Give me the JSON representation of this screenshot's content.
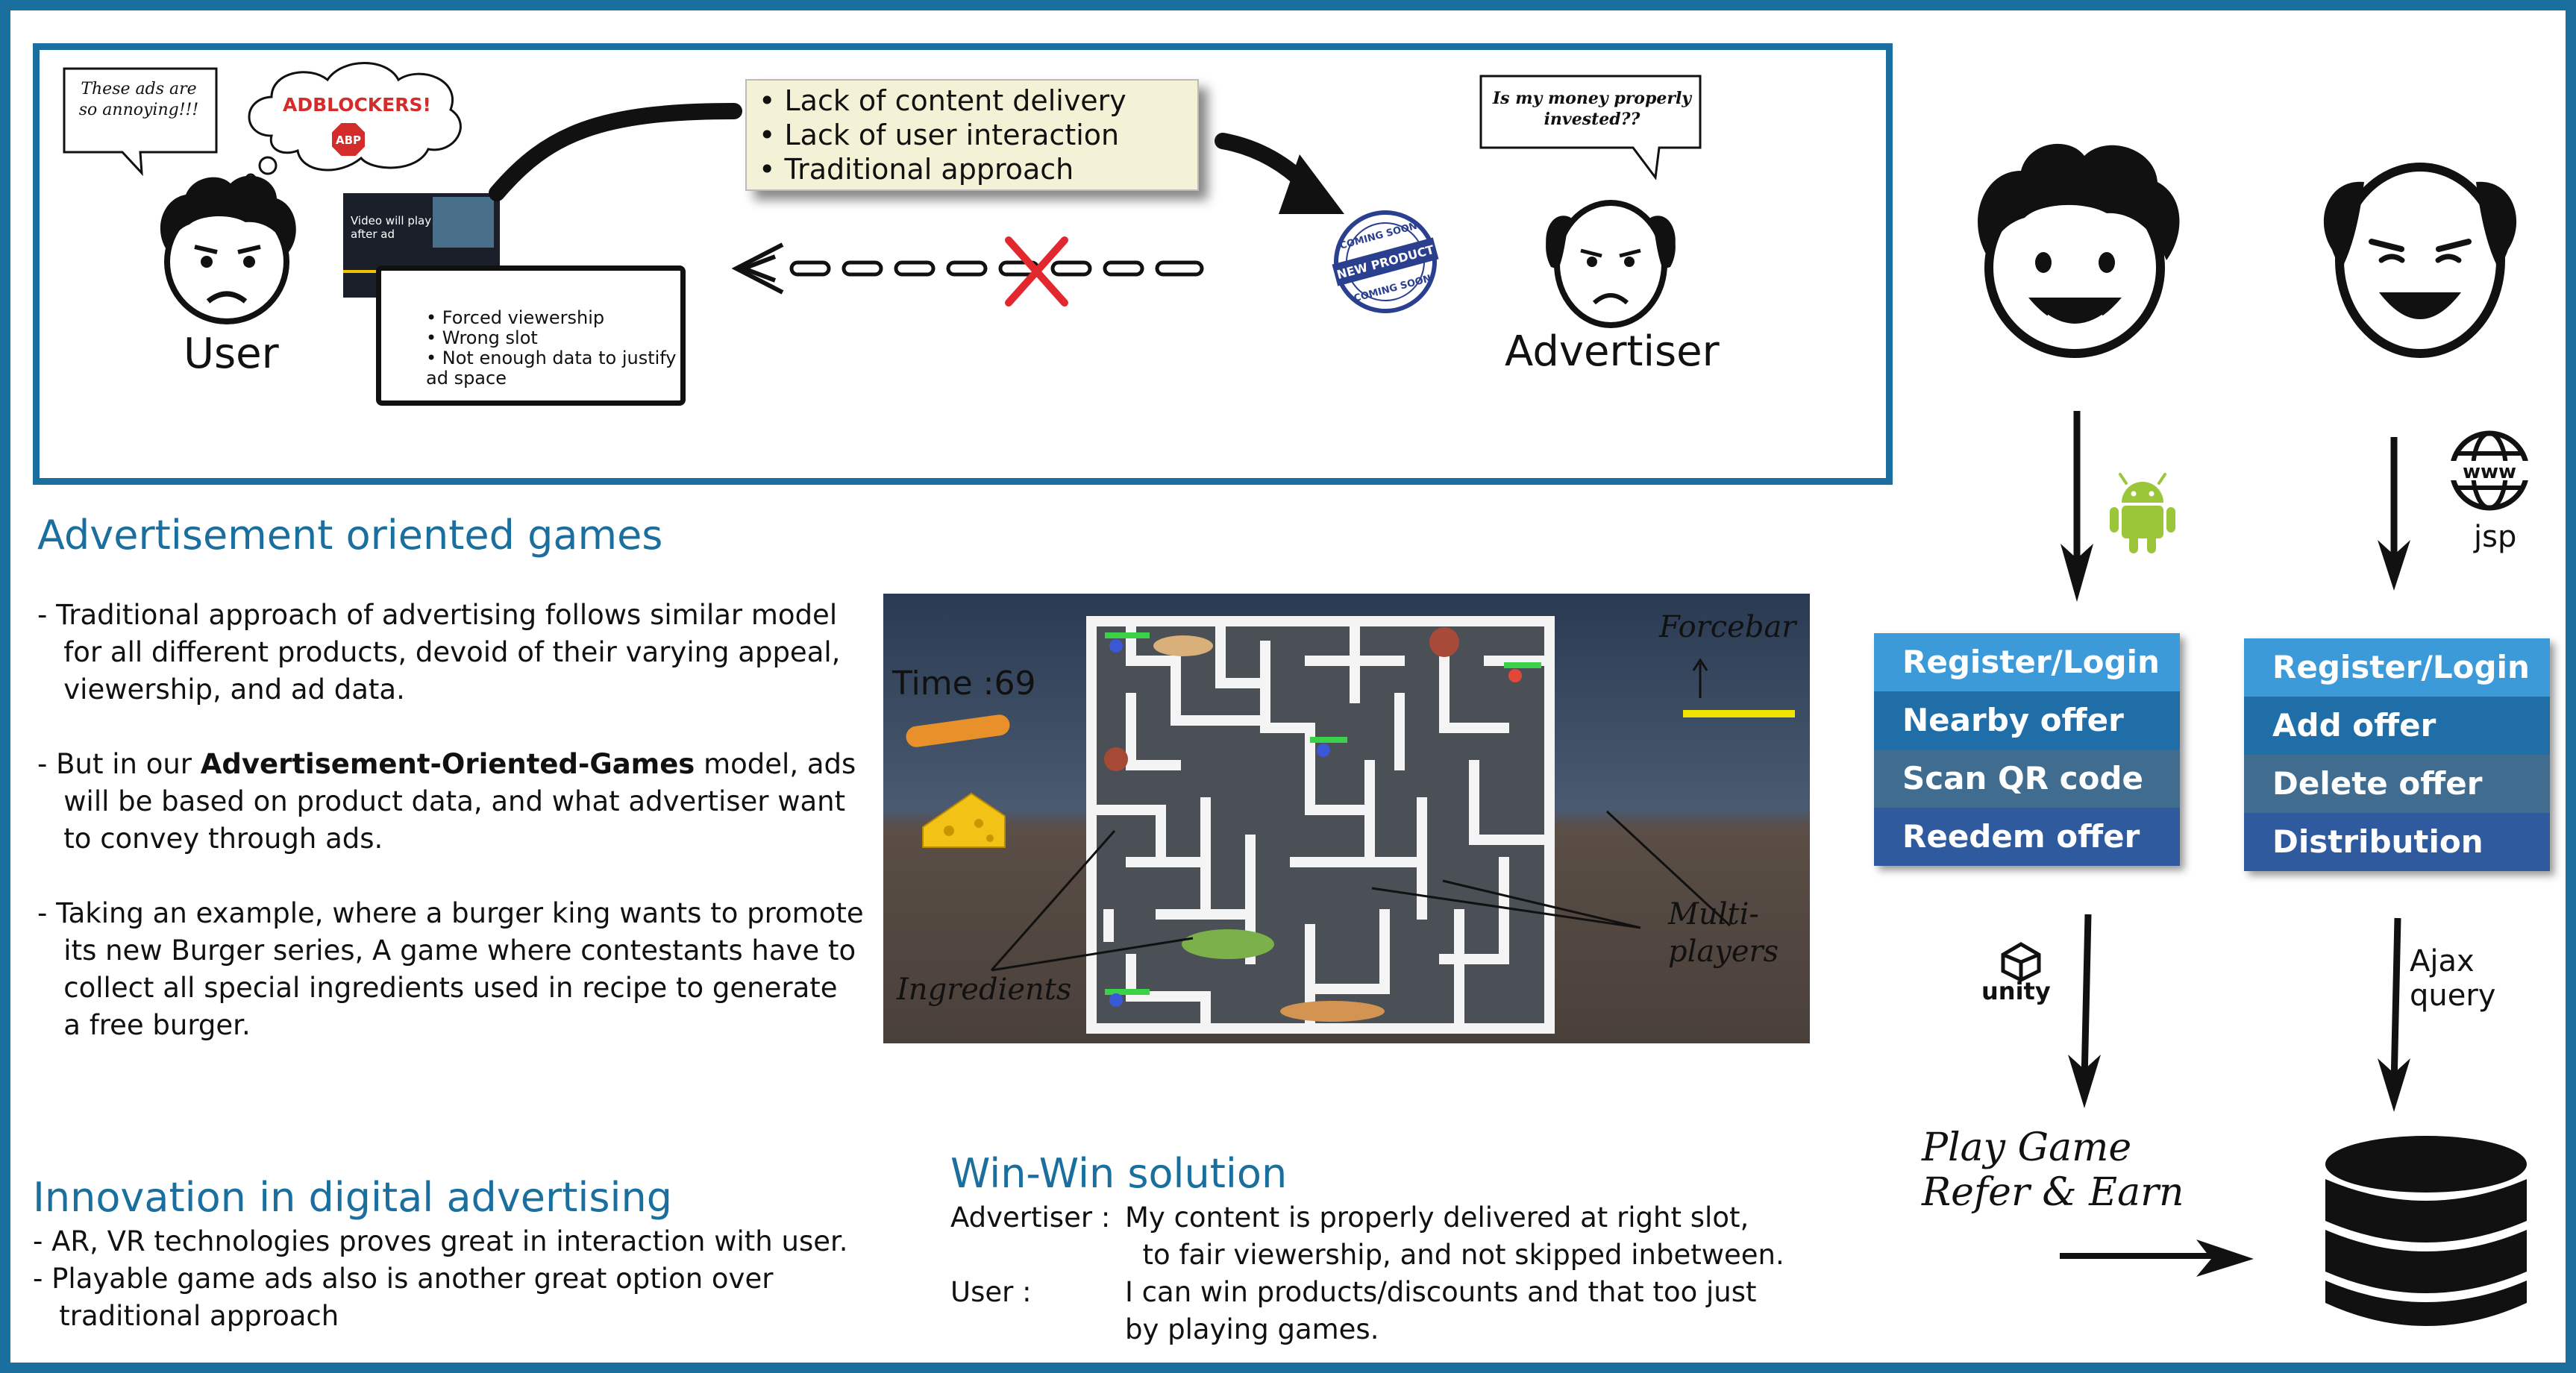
{
  "panel": {
    "user_bubble": [
      "These ads are",
      "so annoying!!!"
    ],
    "adblock_label": "ADBLOCKERS!",
    "abp_label": "ABP",
    "user_label": "User",
    "video_text": [
      "Video will play",
      "after ad"
    ],
    "user_issues": [
      "• Forced viewership",
      "• Wrong slot",
      "• Not enough data to justify",
      "   ad space"
    ],
    "advertiser_issues": [
      "• Lack of content delivery",
      "• Lack of user interaction",
      "• Traditional approach"
    ],
    "stamp_text": [
      "COMING SOON",
      "NEW PRODUCT",
      "COMING SOON"
    ],
    "advertiser_bubble": [
      "Is my money properly",
      "invested??"
    ],
    "advertiser_label": "Advertiser"
  },
  "games": {
    "title": "Advertisement oriented games",
    "p1": [
      "- Traditional approach of advertising follows similar model",
      "   for all different products, devoid of their varying appeal,",
      "   viewership, and ad data."
    ],
    "p2_prefix": "- But in our ",
    "p2_bold": "Advertisement-Oriented-Games",
    "p2_suffix": " model, ads",
    "p2_rest": [
      "   will be based on product data, and what advertiser want",
      "   to convey through ads."
    ],
    "p3": [
      "- Taking an example, where a burger king wants to promote",
      "   its new Burger series, A game where contestants have to",
      "   collect all special ingredients used in recipe to generate",
      "   a free burger."
    ]
  },
  "game_screen": {
    "time": "Time :69",
    "forcebar": "Forcebar",
    "ingredients": "Ingredients",
    "multiplayers": [
      "Multi-",
      "players"
    ]
  },
  "innovation": {
    "title": "Innovation in digital advertising",
    "lines": [
      "- AR, VR technologies proves great in interaction with user.",
      "- Playable game ads also is another great option over",
      "   traditional approach"
    ]
  },
  "winwin": {
    "title": "Win-Win solution",
    "advertiser_label": "Advertiser :",
    "advertiser_lines": [
      "My content is properly delivered at right slot,",
      "  to fair viewership, and not skipped inbetween."
    ],
    "user_label": "User :",
    "user_lines": [
      "I can win products/discounts and that too just",
      "by playing games."
    ]
  },
  "architecture": {
    "jsp_label": "jsp",
    "unity_label": "unity",
    "ajax_label": "Ajax query",
    "user_menu": [
      "Register/Login",
      "Nearby offer",
      "Scan  QR  code",
      "Reedem offer"
    ],
    "advertiser_menu": [
      "Register/Login",
      "Add  offer",
      "Delete  offer",
      "Distribution"
    ],
    "play_game": [
      "Play Game",
      "Refer & Earn"
    ]
  },
  "colors": {
    "accent": "#1a6f9e",
    "menu_1": "#3d9ad9",
    "menu_2": "#1f6ea8",
    "menu_3": "#3f6c8f",
    "menu_4": "#2f5a9e",
    "android": "#9bc63a",
    "forcebar": "#f2e400",
    "cross": "#e0282e"
  },
  "icons": [
    "android-icon",
    "globe-www-icon",
    "unity-icon",
    "database-icon",
    "adblock-stop-icon"
  ]
}
